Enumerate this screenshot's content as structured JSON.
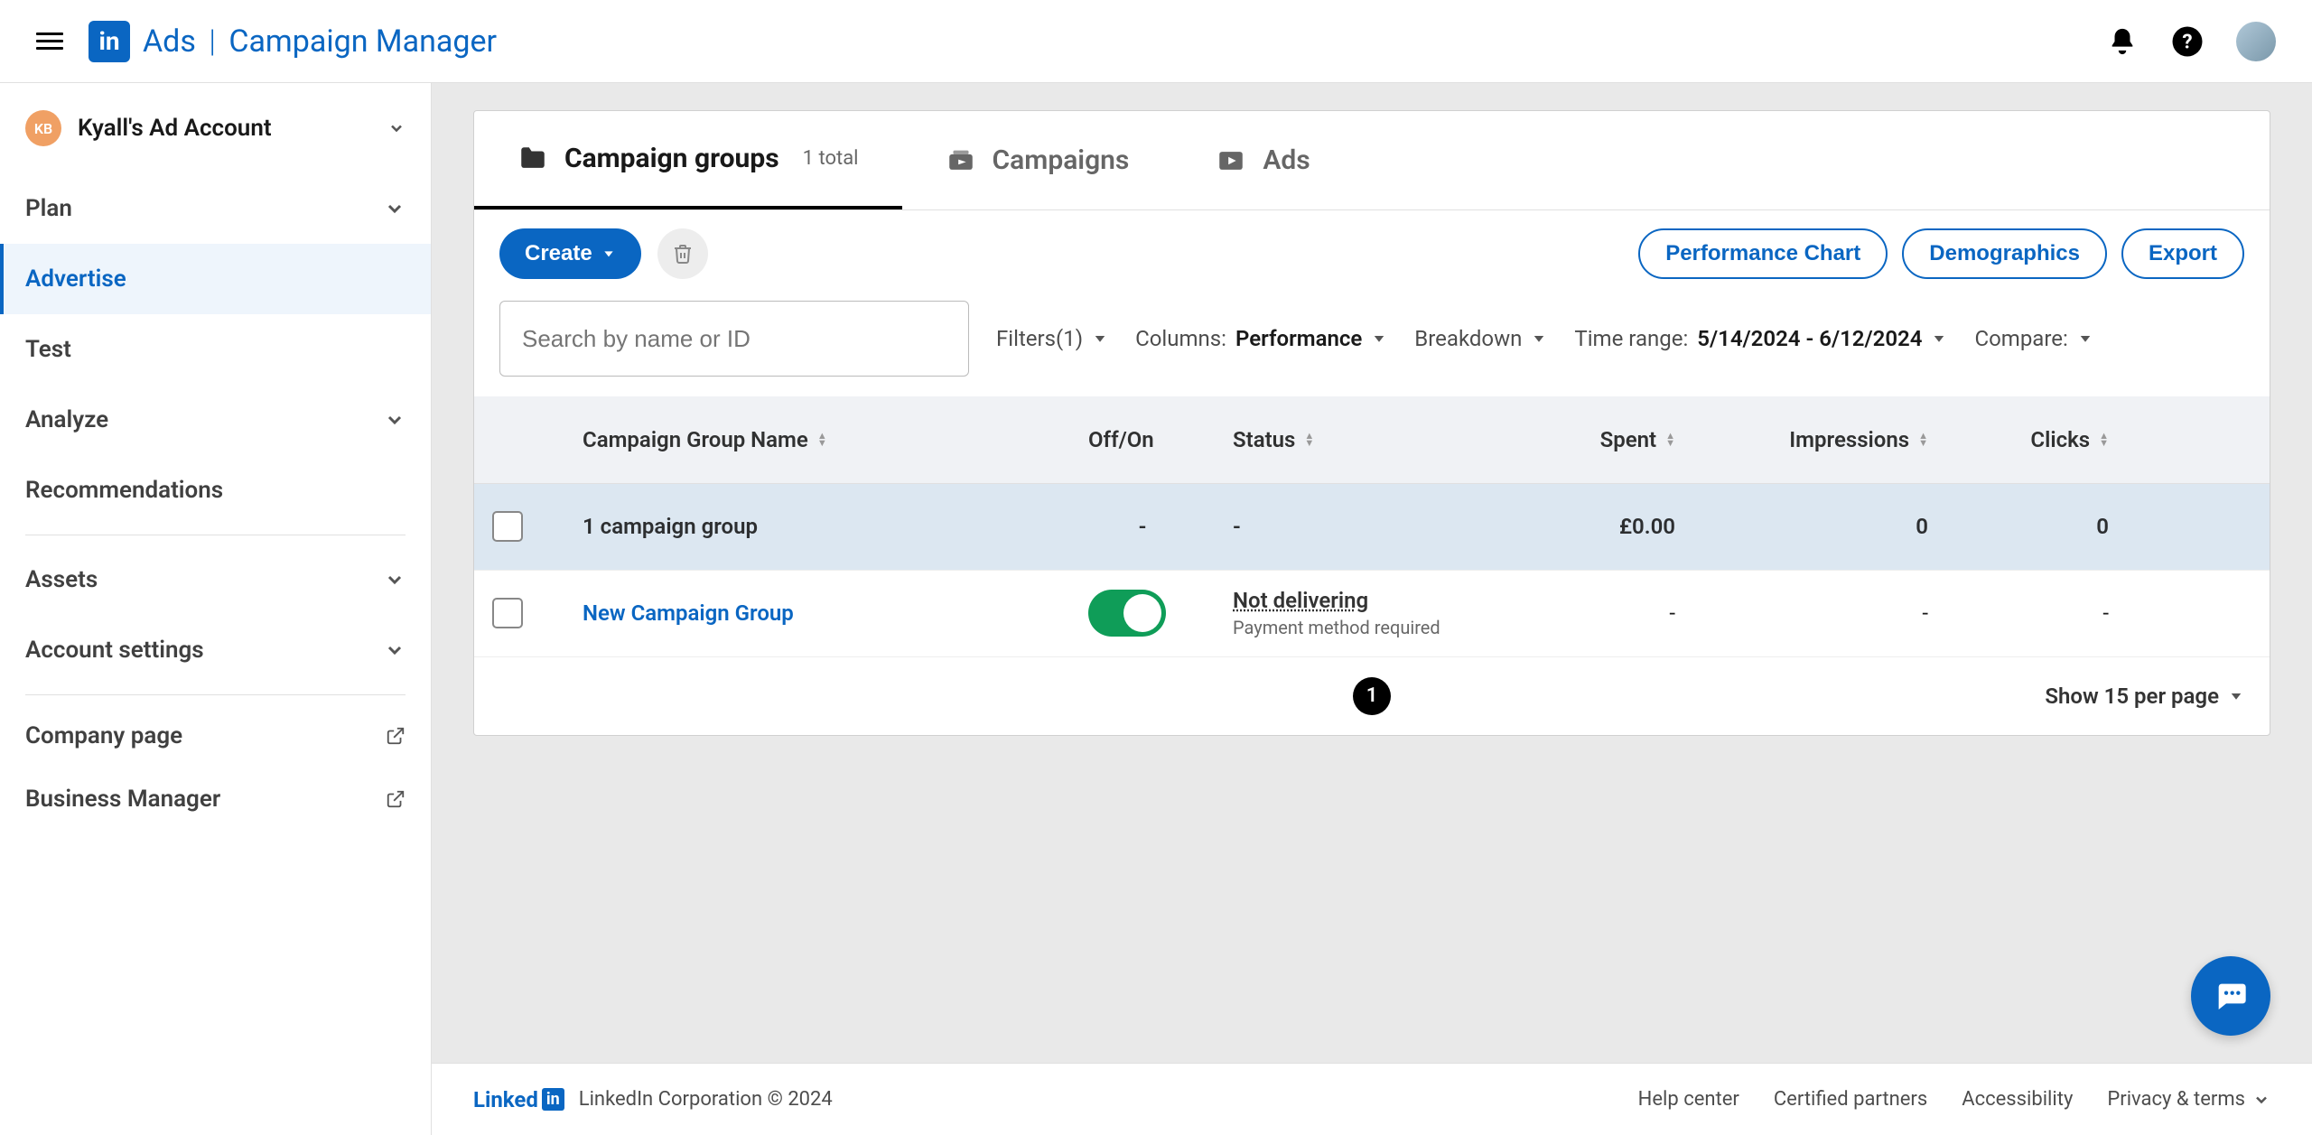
{
  "header": {
    "ads_label": "Ads",
    "cm_label": "Campaign Manager"
  },
  "sidebar": {
    "account_initials": "KB",
    "account_name": "Kyall's Ad Account",
    "nav": {
      "plan": "Plan",
      "advertise": "Advertise",
      "test": "Test",
      "analyze": "Analyze",
      "recommendations": "Recommendations",
      "assets": "Assets",
      "account_settings": "Account settings"
    },
    "links": {
      "company_page": "Company page",
      "business_manager": "Business Manager"
    }
  },
  "tabs": {
    "groups": {
      "label": "Campaign groups",
      "count": "1 total"
    },
    "campaigns": {
      "label": "Campaigns"
    },
    "ads": {
      "label": "Ads"
    }
  },
  "toolbar": {
    "create": "Create",
    "perf_chart": "Performance Chart",
    "demographics": "Demographics",
    "export": "Export"
  },
  "filters": {
    "search_placeholder": "Search by name or ID",
    "filters_label": "Filters(1)",
    "columns_label": "Columns:",
    "columns_value": "Performance",
    "breakdown_label": "Breakdown",
    "time_label": "Time range:",
    "time_value": "5/14/2024 - 6/12/2024",
    "compare_label": "Compare:"
  },
  "table": {
    "headers": {
      "name": "Campaign Group Name",
      "offon": "Off/On",
      "status": "Status",
      "spent": "Spent",
      "impressions": "Impressions",
      "clicks": "Clicks"
    },
    "summary": {
      "name": "1 campaign group",
      "offon": "-",
      "status": "-",
      "spent": "£0.00",
      "impressions": "0",
      "clicks": "0"
    },
    "rows": [
      {
        "name": "New Campaign Group",
        "status_main": "Not delivering",
        "status_sub": "Payment method required",
        "spent": "-",
        "impressions": "-",
        "clicks": "-"
      }
    ]
  },
  "pagination": {
    "page": "1",
    "per_page": "Show 15 per page"
  },
  "footer": {
    "brand1": "Linked",
    "brand2": "in",
    "copyright": "LinkedIn Corporation © 2024",
    "help": "Help center",
    "partners": "Certified partners",
    "accessibility": "Accessibility",
    "privacy": "Privacy & terms"
  }
}
